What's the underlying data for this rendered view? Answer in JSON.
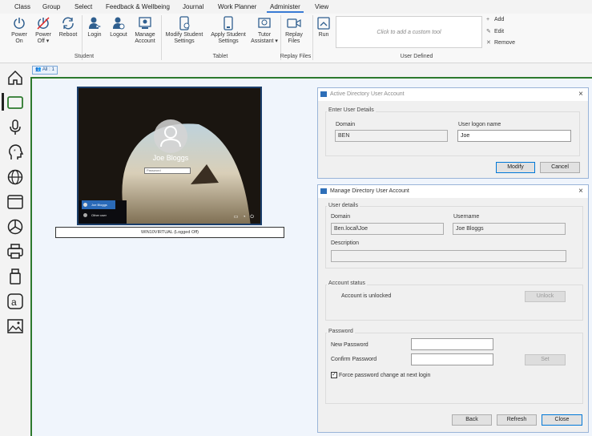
{
  "menu": {
    "tabs": [
      "Class",
      "Group",
      "Select",
      "Feedback & Wellbeing",
      "Journal",
      "Work Planner",
      "Administer",
      "View"
    ],
    "active": "Administer"
  },
  "ribbon": {
    "student": {
      "buttons": [
        {
          "label": "Power",
          "label2": "On",
          "icon": "power-icon"
        },
        {
          "label": "Power",
          "label2": "Off ▾",
          "icon": "power-off-icon"
        },
        {
          "label": "Reboot",
          "label2": "",
          "icon": "reboot-icon"
        },
        {
          "label": "Login",
          "label2": "",
          "icon": "login-icon"
        },
        {
          "label": "Logout",
          "label2": "",
          "icon": "logout-icon"
        },
        {
          "label": "Manage",
          "label2": "Account",
          "icon": "manage-account-icon"
        }
      ],
      "group_label": "Student"
    },
    "tablet": {
      "buttons": [
        {
          "label": "Modify Student",
          "label2": "Settings",
          "icon": "modify-settings-icon"
        },
        {
          "label": "Apply Student",
          "label2": "Settings",
          "icon": "apply-settings-icon"
        },
        {
          "label": "Tutor",
          "label2": "Assistant ▾",
          "icon": "tutor-assistant-icon"
        }
      ],
      "group_label": "Tablet"
    },
    "replay": {
      "buttons": [
        {
          "label": "Replay",
          "label2": "Files",
          "icon": "replay-icon"
        }
      ],
      "group_label": "Replay Files"
    },
    "user_defined": {
      "run_label": "Run",
      "custom_tool_placeholder": "Click to add a custom tool",
      "add": "Add",
      "edit": "Edit",
      "remove": "Remove",
      "group_label": "User Defined"
    }
  },
  "nav_icons": [
    "home-icon",
    "screen-icon",
    "microphone-icon",
    "head-icon",
    "globe-icon",
    "browser-window-icon",
    "pie-chart-icon",
    "printer-icon",
    "usb-icon",
    "text-a-icon",
    "image-icon"
  ],
  "main": {
    "filter_badge": "All : 1",
    "thumbnail": {
      "user_name": "Joe Bloggs",
      "password_placeholder": "Password",
      "users": [
        "Joe Bloggs",
        "Other user"
      ],
      "caption": "WIN10VIRTUAL (Logged Off)"
    }
  },
  "ad_dialog": {
    "title": "Active Directory User Account",
    "section": "Enter User Details",
    "domain_label": "Domain",
    "domain_value": "BEN",
    "logon_label": "User logon name",
    "logon_value": "Joe",
    "modify": "Modify",
    "cancel": "Cancel"
  },
  "manage_dialog": {
    "title": "Manage Directory User Account",
    "details_section": "User details",
    "domain_label": "Domain",
    "domain_value": "Ben.local\\Joe",
    "username_label": "Username",
    "username_value": "Joe Bloggs",
    "description_label": "Description",
    "description_value": "",
    "status_section": "Account status",
    "status_text": "Account is unlocked",
    "unlock": "Unlock",
    "password_section": "Password",
    "new_password_label": "New Password",
    "confirm_password_label": "Confirm Password",
    "set": "Set",
    "force_change_label": "Force password change at next login",
    "force_change_checked": true,
    "back": "Back",
    "refresh": "Refresh",
    "close": "Close"
  }
}
